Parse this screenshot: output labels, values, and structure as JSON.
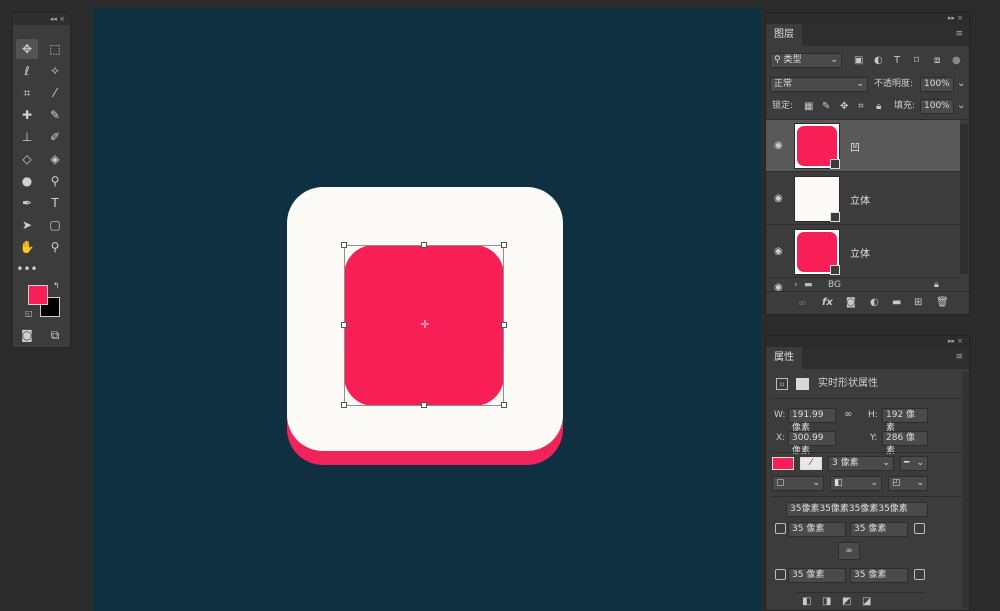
{
  "canvas": {
    "bg": "#0f3040",
    "icon_white": "#fcfaf7",
    "icon_red": "#f81f56",
    "icon_shadow": "#f0245a"
  },
  "toolbox": {
    "collapse": "◂◂ ×",
    "fg_color": "#f81f56",
    "bg_color": "#000000"
  },
  "layers_panel": {
    "collapse": "▸▸ ×",
    "tab": "图层",
    "filter_type": "类型",
    "blend_mode": "正常",
    "opacity_label": "不透明度:",
    "opacity_value": "100%",
    "lock_label": "锁定:",
    "fill_label": "填充:",
    "fill_value": "100%",
    "layers": [
      {
        "name": "凹",
        "color": "#f81f56"
      },
      {
        "name": "立体",
        "color": "#fcfaf7"
      },
      {
        "name": "立体",
        "color": "#f81f56"
      }
    ],
    "group_name": "BG",
    "bottom_icons": [
      "link-icon",
      "fx",
      "mask-icon",
      "adjustment-icon",
      "folder-icon",
      "new-layer-icon",
      "trash-icon"
    ],
    "bottom_fx": "fx"
  },
  "properties_panel": {
    "collapse": "▸▸ ×",
    "tab": "属性",
    "section_title": "实时形状属性",
    "w_label": "W:",
    "w_value": "191.99 像素",
    "h_label": "H:",
    "h_value": "192 像素",
    "x_label": "X:",
    "x_value": "300.99 像素",
    "y_label": "Y:",
    "y_value": "286 像素",
    "fill_color": "#f81f56",
    "stroke_width": "3 像素",
    "corners_all": "35像素35像素35像素35像素",
    "corner_tl": "35 像素",
    "corner_tr": "35 像素",
    "corner_bl": "35 像素",
    "corner_br": "35 像素"
  }
}
